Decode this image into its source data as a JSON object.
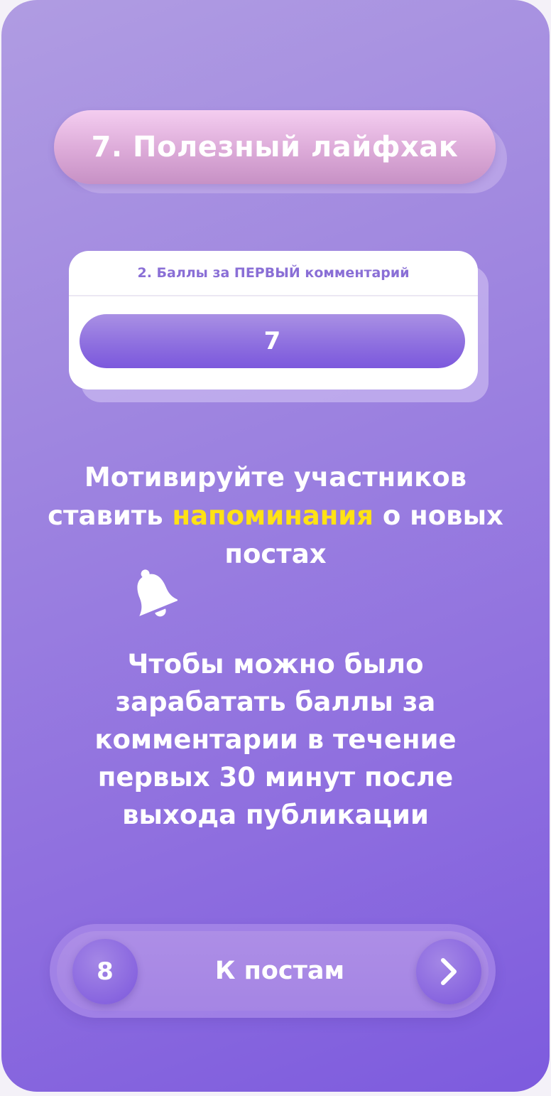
{
  "header": {
    "title": "7. Полезный лайфхак"
  },
  "setting": {
    "label": "2. Баллы за ПЕРВЫЙ комментарий",
    "value": "7"
  },
  "headline": {
    "part1": "Мотивируйте участников ставить ",
    "highlight": "напоминания",
    "part2": " о новых постах"
  },
  "body": {
    "text": "Чтобы можно было зарабатать баллы за комментарии в течение первых 30 минут после выхода публикации"
  },
  "nav": {
    "page_number": "8",
    "label": "К постам",
    "next_icon": "chevron-right-icon"
  },
  "colors": {
    "accent": "#ffe214",
    "background_start": "#b09ce2",
    "background_end": "#7d5bde",
    "title_pill": "#dcaad8",
    "setting_label": "#8a6fd6"
  }
}
